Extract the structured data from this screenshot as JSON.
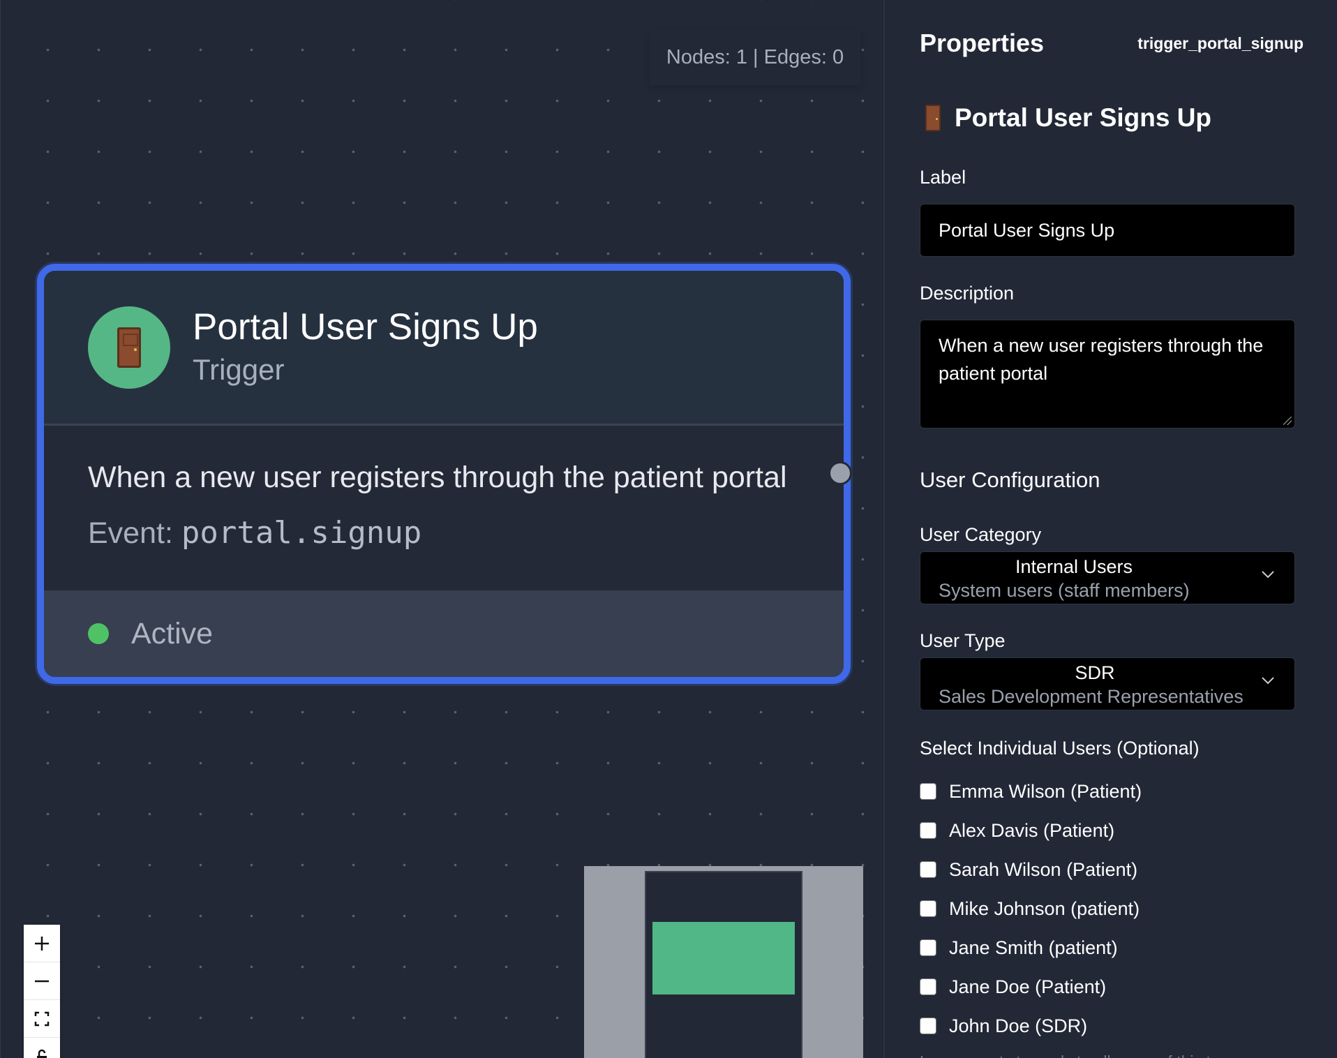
{
  "canvas": {
    "stats": "Nodes: 1 | Edges: 0",
    "node": {
      "icon": "door-icon",
      "title": "Portal User Signs Up",
      "type": "Trigger",
      "description": "When a new user registers through the patient portal",
      "event_label": "Event:",
      "event_code": "portal.signup",
      "status": "Active"
    },
    "controls": [
      "zoom-in-icon",
      "zoom-out-icon",
      "fit-view-icon",
      "lock-icon"
    ]
  },
  "panel": {
    "title": "Properties",
    "node_id": "trigger_portal_signup",
    "node_icon": "door-icon",
    "node_title": "Portal User Signs Up",
    "label_field": {
      "label": "Label",
      "value": "Portal User Signs Up"
    },
    "description_field": {
      "label": "Description",
      "value": "When a new user registers through the patient portal"
    },
    "section": "User Configuration",
    "user_category": {
      "label": "User Category",
      "value": "Internal Users",
      "sub": "System users (staff members)"
    },
    "user_type": {
      "label": "User Type",
      "value": "SDR",
      "sub": "Sales Development Representatives"
    },
    "users_label": "Select Individual Users (Optional)",
    "users": [
      "Emma Wilson (Patient)",
      "Alex Davis (Patient)",
      "Sarah Wilson (Patient)",
      "Mike Johnson (patient)",
      "Jane Smith (patient)",
      "Jane Doe (Patient)",
      "John Doe (SDR)"
    ],
    "hint": "Leave empty to apply to all users of this type"
  },
  "colors": {
    "background": "#222836",
    "node_border": "#3f69e8",
    "icon_circle": "#55b786",
    "active": "#4fc266",
    "input_bg": "#000000"
  }
}
